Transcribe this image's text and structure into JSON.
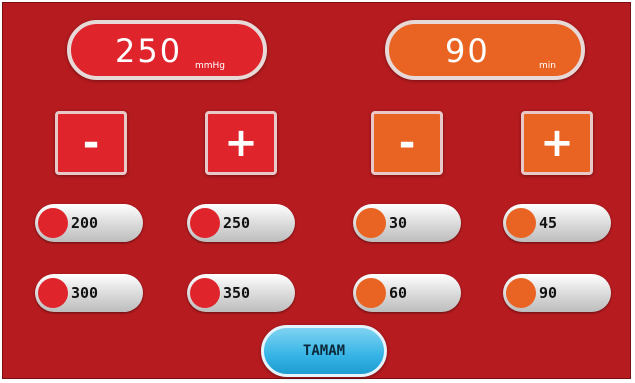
{
  "pressure_display": {
    "value": "250",
    "unit": "mmHg"
  },
  "time_display": {
    "value": "90",
    "unit": "min"
  },
  "pressure_controls": {
    "decrease_label": "-",
    "increase_label": "+"
  },
  "time_controls": {
    "decrease_label": "-",
    "increase_label": "+"
  },
  "pressure_presets": [
    "200",
    "250",
    "300",
    "350"
  ],
  "time_presets": [
    "30",
    "45",
    "60",
    "90"
  ],
  "ok_button": {
    "label": "TAMAM"
  },
  "colors": {
    "background": "#b51b1f",
    "pressure_accent": "#e0242c",
    "time_accent": "#e96422",
    "ok_button": "#35b4e6"
  }
}
